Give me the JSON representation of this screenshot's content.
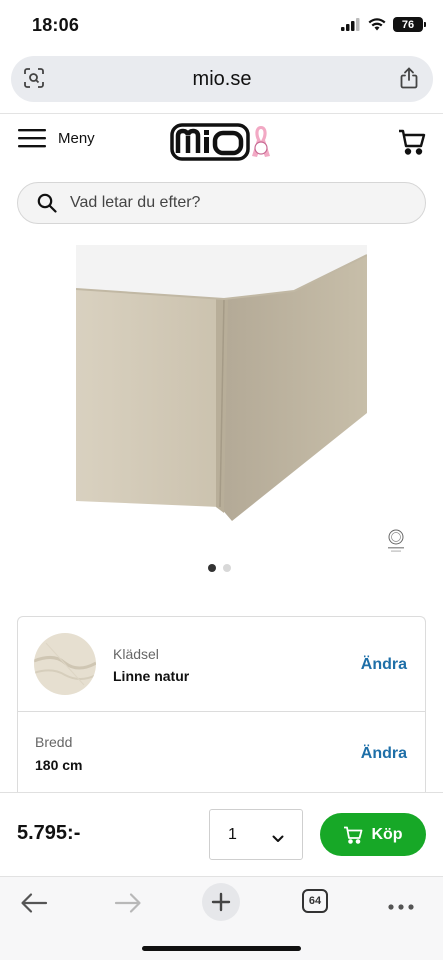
{
  "status": {
    "time": "18:06",
    "battery": "76"
  },
  "browser": {
    "url": "mio.se",
    "tab_count": "64"
  },
  "header": {
    "menu_label": "Meny",
    "logo_text": "mio"
  },
  "search": {
    "placeholder": "Vad letar du efter?"
  },
  "gallery": {
    "dots_total": 2,
    "active_index": 0
  },
  "options": [
    {
      "label": "Klädsel",
      "value": "Linne natur",
      "action": "Ändra"
    },
    {
      "label": "Bredd",
      "value": "180 cm",
      "action": "Ändra"
    }
  ],
  "buy": {
    "price": "5.795:-",
    "quantity": "1",
    "button_label": "Köp"
  },
  "colors": {
    "accent_green": "#17a827",
    "link_blue": "#1e6fa8",
    "fabric": "#d8d0bf"
  },
  "icons": [
    "screen-search-icon",
    "share-icon",
    "hamburger-icon",
    "cart-icon",
    "search-icon",
    "chevron-down-icon",
    "back-icon",
    "forward-icon",
    "new-tab-icon",
    "tabs-icon",
    "more-icon"
  ]
}
